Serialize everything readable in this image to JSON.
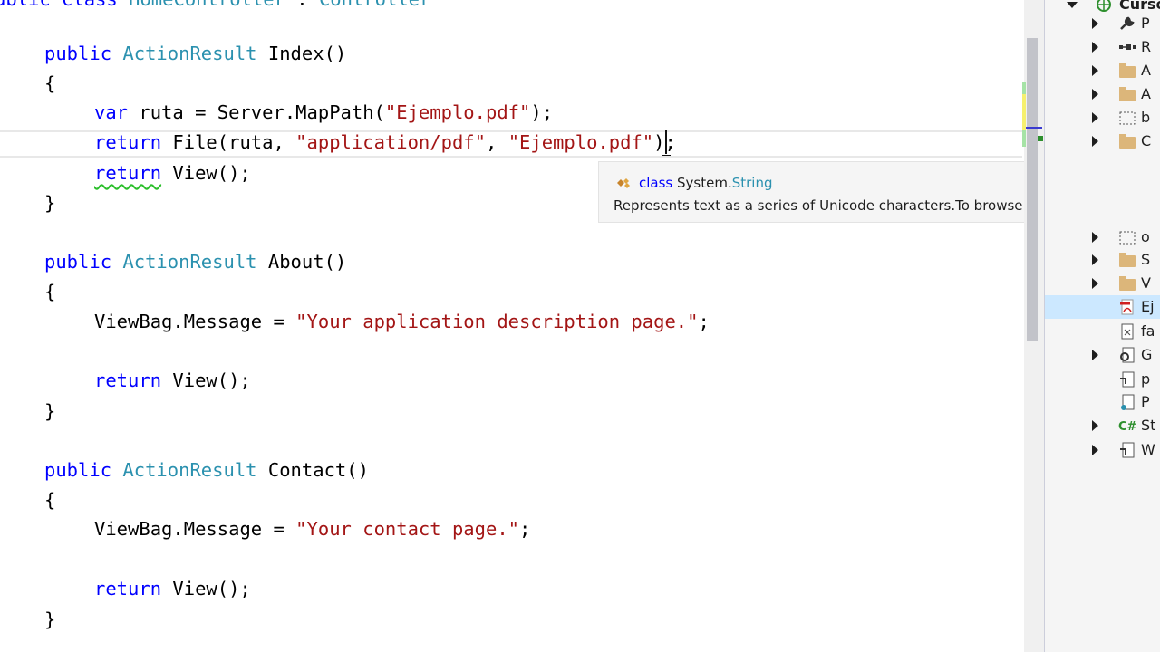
{
  "editor": {
    "lines": {
      "l0a": "ublic class ",
      "l0b": "HomeController",
      "l0c": " : ",
      "l0d": "Controller",
      "index_kw": "public ",
      "index_type": "ActionResult",
      "index_name": " Index()",
      "open1": "{",
      "var_kw": "var",
      "var_rest": " ruta = Server.MapPath(",
      "var_str": "\"Ejemplo.pdf\"",
      "var_end": ");",
      "ret1_kw": "return",
      "ret1_a": " File(ruta, ",
      "ret1_s1": "\"application/pdf\"",
      "ret1_b": ", ",
      "ret1_s2": "\"Ejemplo.pdf\"",
      "ret1_end": ");",
      "ret2_kw": "return",
      "ret2_rest": " View();",
      "close1": "}",
      "about_kw": "public ",
      "about_type": "ActionResult",
      "about_name": " About()",
      "open2": "{",
      "msg1_a": "ViewBag.Message = ",
      "msg1_s": "\"Your application description page.\"",
      "msg1_end": ";",
      "ret3_kw": "return",
      "ret3_rest": " View();",
      "close2": "}",
      "contact_kw": "public ",
      "contact_type": "ActionResult",
      "contact_name": " Contact()",
      "open3": "{",
      "msg2_a": "ViewBag.Message = ",
      "msg2_s": "\"Your contact page.\"",
      "msg2_end": ";",
      "ret4_kw": "return",
      "ret4_rest": " View();",
      "close3": "}"
    }
  },
  "tooltip": {
    "keyword": "class",
    "namespace": "System.",
    "type": "String",
    "description": "Represents text as a series of Unicode characters.To browse the .NET Framewor"
  },
  "solution_explorer": {
    "items": [
      {
        "label": "Curso",
        "icon": "globe-icon"
      },
      {
        "label": "P",
        "icon": "wrench-icon"
      },
      {
        "label": "R",
        "icon": "references-icon"
      },
      {
        "label": "A",
        "icon": "folder-icon"
      },
      {
        "label": "A",
        "icon": "folder-icon"
      },
      {
        "label": "b",
        "icon": "dotted-folder-icon"
      },
      {
        "label": "C",
        "icon": "folder-icon"
      },
      {
        "label": "o",
        "icon": "dotted-folder-icon"
      },
      {
        "label": "S",
        "icon": "folder-icon"
      },
      {
        "label": "V",
        "icon": "folder-icon"
      },
      {
        "label": "Ej",
        "icon": "pdf-icon"
      },
      {
        "label": "fa",
        "icon": "file-icon"
      },
      {
        "label": "G",
        "icon": "config-file-icon"
      },
      {
        "label": "p",
        "icon": "config-file-icon"
      },
      {
        "label": "P",
        "icon": "page-icon"
      },
      {
        "label": "St",
        "icon": "csharp-file-icon"
      },
      {
        "label": "W",
        "icon": "config-file-icon"
      }
    ]
  },
  "colors": {
    "keyword": "#0000ff",
    "type": "#2b91af",
    "string": "#a31515",
    "selection": "#cce8ff"
  }
}
